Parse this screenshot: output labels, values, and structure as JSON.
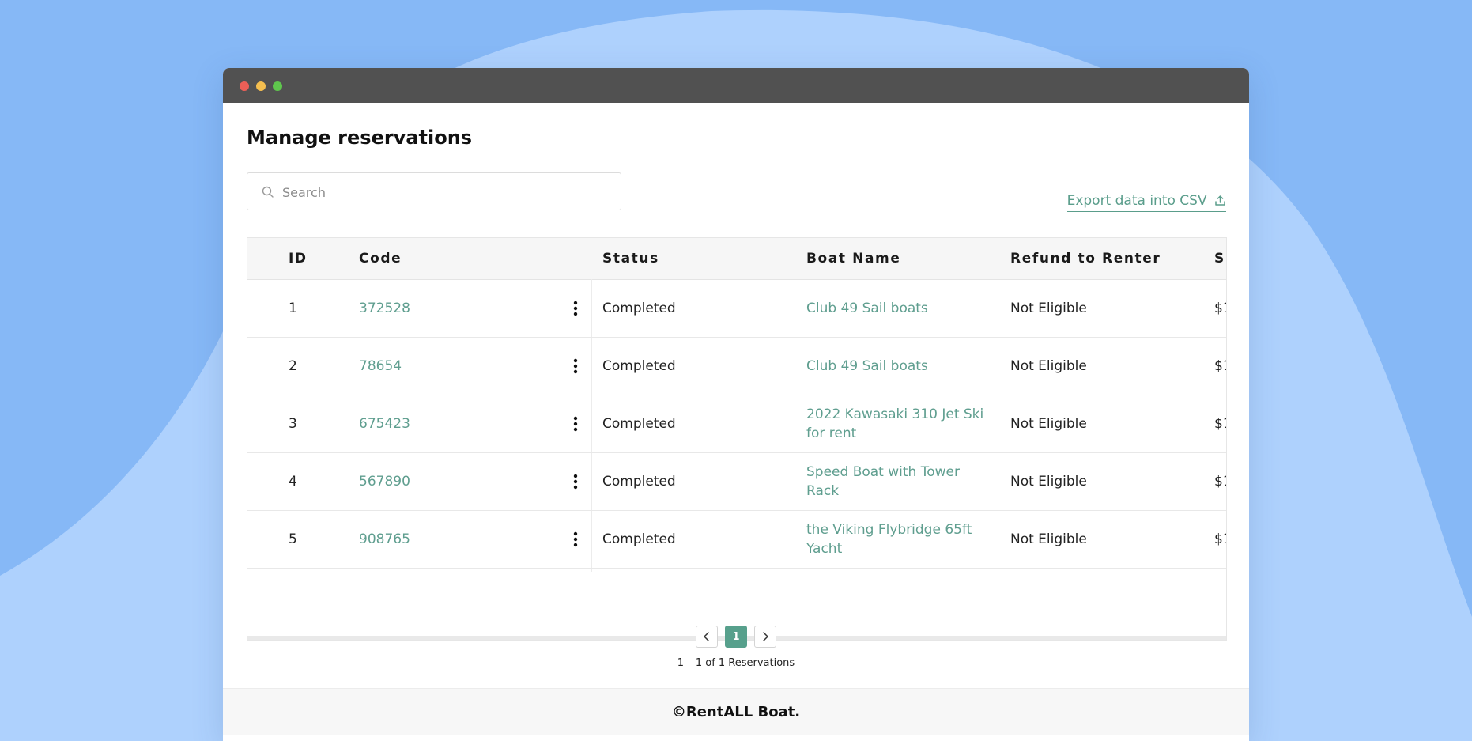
{
  "page": {
    "title": "Manage reservations"
  },
  "search": {
    "placeholder": "Search"
  },
  "export": {
    "label": "Export data into CSV"
  },
  "table": {
    "headers": [
      "ID",
      "Code",
      "Status",
      "Boat Name",
      "Refund to Renter",
      "Su"
    ],
    "rows": [
      {
        "id": "1",
        "code": "372528",
        "status": "Completed",
        "boat": "Club 49 Sail boats",
        "refund": "Not Eligible",
        "sub": "$1"
      },
      {
        "id": "2",
        "code": "78654",
        "status": "Completed",
        "boat": "Club 49 Sail boats",
        "refund": "Not Eligible",
        "sub": "$1"
      },
      {
        "id": "3",
        "code": "675423",
        "status": "Completed",
        "boat": "2022 Kawasaki 310 Jet Ski for rent",
        "refund": "Not Eligible",
        "sub": "$1"
      },
      {
        "id": "4",
        "code": "567890",
        "status": "Completed",
        "boat": "Speed Boat with Tower Rack",
        "refund": "Not Eligible",
        "sub": "$1"
      },
      {
        "id": "5",
        "code": "908765",
        "status": "Completed",
        "boat": "the Viking Flybridge 65ft Yacht",
        "refund": "Not Eligible",
        "sub": "$1"
      }
    ]
  },
  "pagination": {
    "current": "1",
    "info": "1 – 1 of 1 Reservations"
  },
  "footer": {
    "text": "©RentALL Boat."
  },
  "colors": {
    "accent": "#57a08c",
    "link": "#5f9e8f",
    "titlebar": "#515151",
    "background": "#86b8f6"
  },
  "icons": {
    "search": "search-icon",
    "export": "upload-icon",
    "row_menu": "kebab-menu-icon",
    "prev": "chevron-left-icon",
    "next": "chevron-right-icon"
  }
}
